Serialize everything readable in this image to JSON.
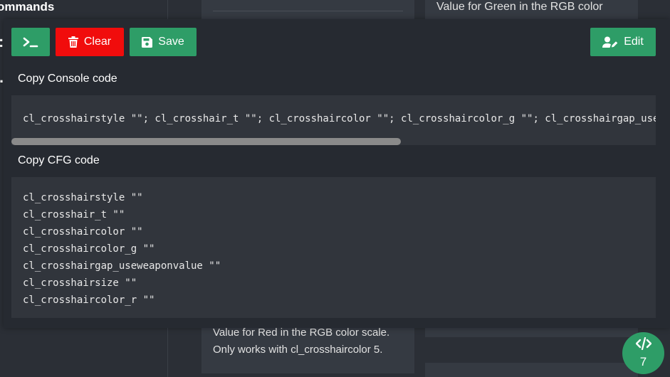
{
  "background": {
    "left_title": "ommands",
    "left_glyph_1": ":",
    "left_glyph_2": ".",
    "mid_card_text": "Value for Red in the RGB color scale. Only works with cl_crosshaircolor 5.",
    "right_card_text": "Value for Green in the RGB color"
  },
  "toolbar": {
    "console_icon": "terminal-icon",
    "clear_label": "Clear",
    "clear_icon": "trash-icon",
    "save_label": "Save",
    "save_icon": "floppy-disk-icon",
    "edit_label": "Edit",
    "edit_icon": "user-edit-icon"
  },
  "console": {
    "label": "Copy Console code",
    "code": "cl_crosshairstyle \"\"; cl_crosshair_t \"\"; cl_crosshaircolor \"\"; cl_crosshaircolor_g \"\"; cl_crosshairgap_useweaponvalue \"\"; cl_crosshairsize \"\"; cl_crosshaircolor_r \"\""
  },
  "cfg": {
    "label": "Copy CFG code",
    "lines": [
      "cl_crosshairstyle \"\"",
      "cl_crosshair_t \"\"",
      "cl_crosshaircolor \"\"",
      "cl_crosshaircolor_g \"\"",
      "cl_crosshairgap_useweaponvalue \"\"",
      "cl_crosshairsize \"\"",
      "cl_crosshaircolor_r \"\""
    ]
  },
  "fab": {
    "icon": "code-icon",
    "count": "7"
  },
  "colors": {
    "accent_green": "#2e9d67",
    "danger_red": "#f10c0c",
    "panel_bg": "#262a31",
    "code_bg": "#31353c"
  }
}
